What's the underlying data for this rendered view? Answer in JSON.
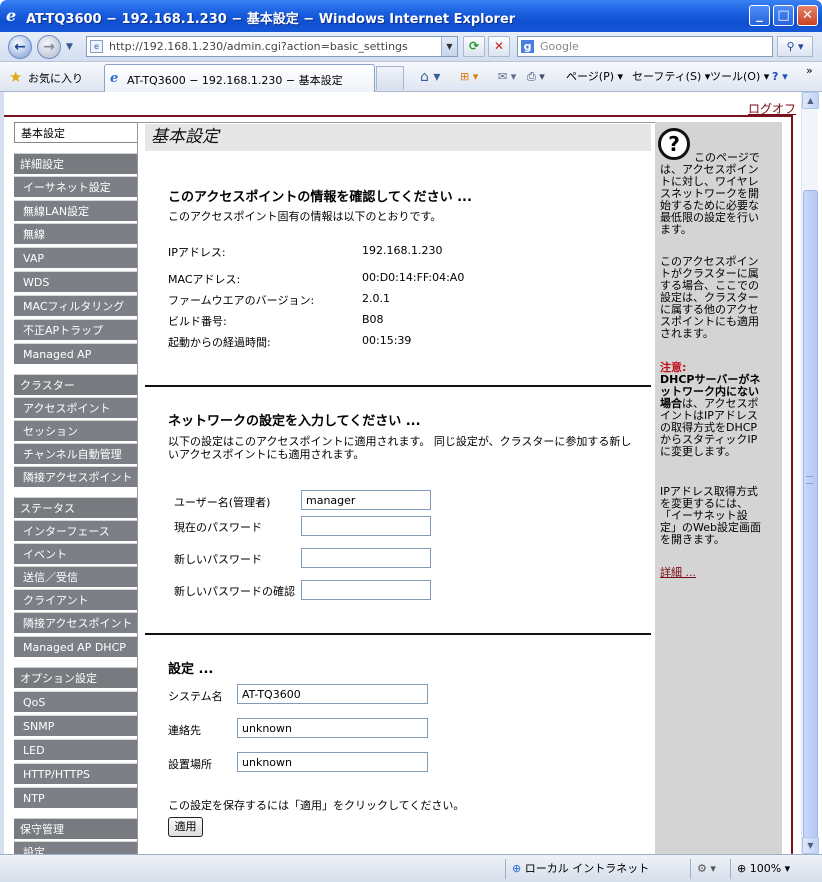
{
  "window": {
    "title": "AT-TQ3600 − 192.168.1.230 − 基本設定 − Windows Internet Explorer",
    "minimize": "_",
    "maximize": "□",
    "close": "✕"
  },
  "addressbar": {
    "url": "http://192.168.1.230/admin.cgi?action=basic_settings",
    "search_placeholder": "Google"
  },
  "favbar": {
    "favorites_label": "お気に入り",
    "tab_title": "AT-TQ3600 − 192.168.1.230 − 基本設定",
    "commands": {
      "page": "ページ(P)",
      "safety": "セーフティ(S)",
      "tools": "ツール(O)"
    }
  },
  "page": {
    "logoff": "ログオフ",
    "title": "基本設定"
  },
  "nav": {
    "basic": "基本設定",
    "advanced": "詳細設定",
    "ethernet": "イーサネット設定",
    "wlan": "無線LAN設定",
    "wireless": "無線",
    "vap": "VAP",
    "wds": "WDS",
    "mac_filter": "MACフィルタリング",
    "rogue_ap": "不正APトラップ",
    "managed_ap": "Managed AP",
    "cluster": "クラスター",
    "access_points": "アクセスポイント",
    "sessions": "セッション",
    "channel_mgmt": "チャンネル自動管理",
    "neighbor_ap_cluster": "隣接アクセスポイント",
    "status": "ステータス",
    "interfaces": "インターフェース",
    "events": "イベント",
    "tx_rx": "送信／受信",
    "clients": "クライアント",
    "neighbor_ap_status": "隣接アクセスポイント",
    "managed_ap_dhcp": "Managed AP DHCP",
    "options": "オプション設定",
    "qos": "QoS",
    "snmp": "SNMP",
    "led": "LED",
    "http": "HTTP/HTTPS",
    "ntp": "NTP",
    "maintenance": "保守管理",
    "settings": "設定"
  },
  "info": {
    "heading": "このアクセスポイントの情報を確認してください ...",
    "desc": "このアクセスポイント固有の情報は以下のとおりです。",
    "ip_label": "IPアドレス:",
    "ip_value": "192.168.1.230",
    "mac_label": "MACアドレス:",
    "mac_value": "00:D0:14:FF:04:A0",
    "fw_label": "ファームウエアのバージョン:",
    "fw_value": "2.0.1",
    "build_label": "ビルド番号:",
    "build_value": "B08",
    "uptime_label": "起動からの経過時間:",
    "uptime_value": "00:15:39"
  },
  "network": {
    "heading": "ネットワークの設定を入力してください ...",
    "desc1": "以下の設定はこのアクセスポイントに適用されます。 同じ設定が、クラスターに参加する新し",
    "desc2": "いアクセスポイントにも適用されます。",
    "user_label": "ユーザー名(管理者)",
    "user_value": "manager",
    "cur_pw_label": "現在のパスワード",
    "new_pw_label": "新しいパスワード",
    "confirm_pw_label": "新しいパスワードの確認"
  },
  "settings": {
    "heading": "設定 ...",
    "sysname_label": "システム名",
    "sysname_value": "AT-TQ3600",
    "contact_label": "連絡先",
    "contact_value": "unknown",
    "location_label": "設置場所",
    "location_value": "unknown",
    "save_note": "この設定を保存するには「適用」をクリックしてください。",
    "apply_label": "適用"
  },
  "help": {
    "p1a": "このページでは、アクセスポイントに対し、ワイヤレスネットワークを開始するために必要な最低限の設定を行います。",
    "p2": "このアクセスポイントがクラスターに属する場合、ここでの設定は、クラスターに属する他のアクセスポイントにも適用されます。",
    "note_title": "注意:",
    "note_bold": "DHCPサーバーがネットワーク内にない場合",
    "note_rest": "は、アクセスポイントはIPアドレスの取得方式をDHCPからスタティックIPに変更します。",
    "p4": "IPアドレス取得方式を変更するには、「イーサネット設定」のWeb設定画面を開きます。",
    "more": "詳細 ..."
  },
  "statusbar": {
    "zone": "ローカル イントラネット",
    "zoom": "100%"
  }
}
